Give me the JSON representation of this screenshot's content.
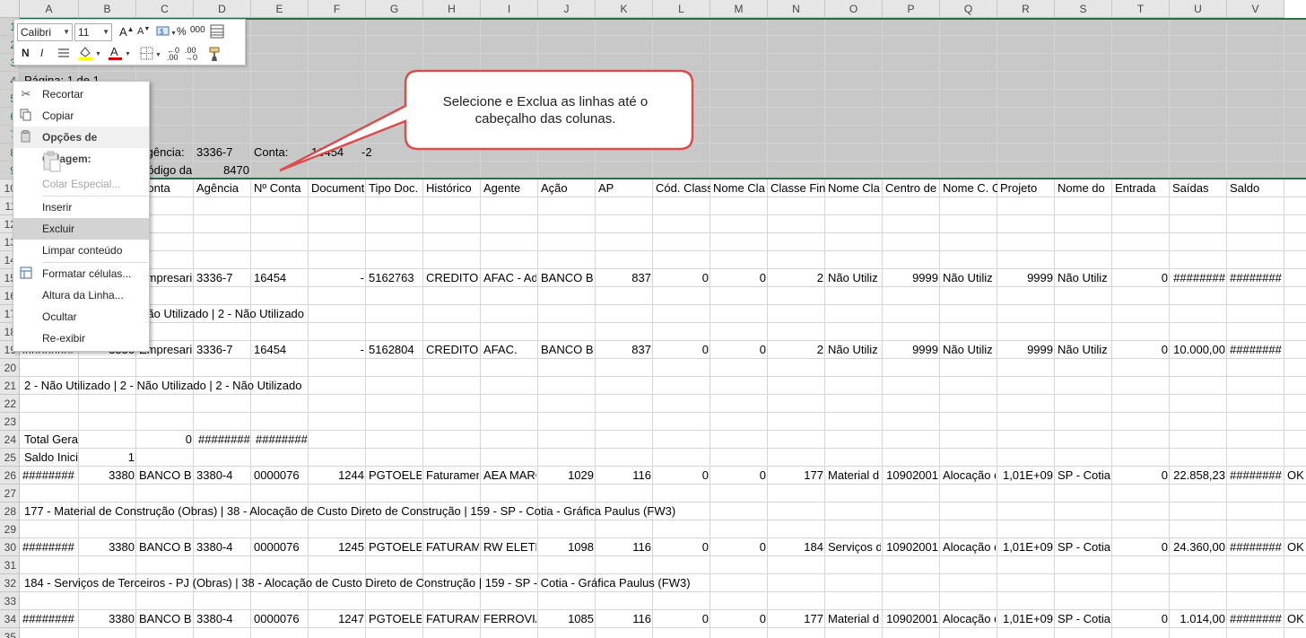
{
  "columns": [
    "A",
    "B",
    "C",
    "D",
    "E",
    "F",
    "G",
    "H",
    "I",
    "J",
    "K",
    "L",
    "M",
    "N",
    "O",
    "P",
    "Q",
    "R",
    "S",
    "T",
    "U",
    "V"
  ],
  "rows": [
    "1",
    "2",
    "3",
    "4",
    "5",
    "6",
    "7",
    "8",
    "9",
    "10",
    "11",
    "12",
    "13",
    "14",
    "15",
    "16",
    "17",
    "18",
    "19",
    "20",
    "21",
    "22",
    "23",
    "24",
    "25",
    "26",
    "27",
    "28",
    "29",
    "30",
    "31",
    "32",
    "33",
    "34",
    "35"
  ],
  "cells": {
    "r4_a": "Página: 1 de 1",
    "r8_c": "Agência:",
    "r8_d": "3336-7",
    "r8_e": "Conta:",
    "r8_f": "16454",
    "r8_g": "-2",
    "r9_c": "Código da",
    "r9_d": "8470",
    "h_c": "Conta",
    "h_d": "Agência",
    "h_e": "Nº Conta",
    "h_f": "Document",
    "h_g": "Tipo Doc.",
    "h_h": "Histórico",
    "h_i": "Agente",
    "h_j": "Ação",
    "h_k": "AP",
    "h_l": "Cód. Class",
    "h_m": "Nome Cla",
    "h_n": "Classe Fin",
    "h_o": "Nome Cla",
    "h_p": "Centro de",
    "h_q": "Nome C. C",
    "h_r": "Projeto",
    "h_s": "Nome do",
    "h_t": "Entrada",
    "h_u": "Saídas",
    "h_v": "Saldo",
    "r15": [
      "",
      "",
      "Empresari",
      "3336-7",
      "16454",
      "-",
      "5162763",
      "CREDITO",
      "AFAC - Ad",
      "BANCO BRADESCO S.",
      "837",
      "0",
      "0",
      "2",
      "Não Utiliz",
      "9999",
      "Não Utiliz",
      "9999",
      "Não Utiliz",
      "0",
      "########",
      "########"
    ],
    "r17_c": "Não Utilizado | 2 - Não Utilizado",
    "r19": [
      "########",
      "3336",
      "Empresari",
      "3336-7",
      "16454",
      "-",
      "5162804",
      "CREDITO",
      "AFAC.",
      "BANCO BRADESCO S.",
      "837",
      "0",
      "0",
      "2",
      "Não Utiliz",
      "9999",
      "Não Utiliz",
      "9999",
      "Não Utiliz",
      "0",
      "10.000,00",
      "########"
    ],
    "r21_a": "2 - Não Utilizado | 2 - Não Utilizado | 2 - Não Utilizado",
    "r24_a": "Total Gera",
    "r24_c": "0",
    "r24_d": "########",
    "r24_e": "########",
    "r25_a": "Saldo Inici",
    "r25_b": "1",
    "r26": [
      "########",
      "3380",
      "BANCO BR",
      "3380-4",
      "0000076",
      "1244",
      "PGTOELET",
      "Faturamen",
      "AEA MARC",
      "1029",
      "116",
      "0",
      "0",
      "177",
      "Material d",
      "10902001",
      "Alocação d",
      "1,01E+09",
      "SP - Cotia",
      "0",
      "22.858,23",
      "########",
      "OK"
    ],
    "r28_a": "177 - Material de Construção (Obras) | 38 - Alocação de Custo Direto de Construção | 159 - SP - Cotia - Gráfica Paulus (FW3)",
    "r30": [
      "########",
      "3380",
      "BANCO BR",
      "3380-4",
      "0000076",
      "1245",
      "PGTOELET",
      "FATURAM",
      "RW ELETR",
      "1098",
      "116",
      "0",
      "0",
      "184",
      "Serviços d",
      "10902001",
      "Alocação d",
      "1,01E+09",
      "SP - Cotia",
      "0",
      "24.360,00",
      "########",
      "OK"
    ],
    "r32_a": "184 - Serviços de Terceiros - PJ (Obras) | 38 - Alocação de Custo Direto de Construção | 159 - SP - Cotia - Gráfica Paulus (FW3)",
    "r34": [
      "########",
      "3380",
      "BANCO BR",
      "3380-4",
      "0000076",
      "1247",
      "PGTOELET",
      "FATURAM",
      "FERROVIA",
      "1085",
      "116",
      "0",
      "0",
      "177",
      "Material d",
      "10902001",
      "Alocação d",
      "1,01E+09",
      "SP - Cotia",
      "0",
      "1.014,00",
      "########",
      "OK"
    ]
  },
  "mini_toolbar": {
    "font_name": "Calibri",
    "font_size": "11",
    "bold": "N",
    "italic": "I",
    "increase_font": "A",
    "font_color_glyph": "A",
    "percent": "%",
    "thousands": "000"
  },
  "context_menu": {
    "recortar": "Recortar",
    "copiar": "Copiar",
    "opcoes_colagem": "Opções de Colagem:",
    "colar_especial": "Colar Especial...",
    "inserir": "Inserir",
    "excluir": "Excluir",
    "limpar": "Limpar conteúdo",
    "formatar": "Formatar células...",
    "altura": "Altura da Linha...",
    "ocultar": "Ocultar",
    "reexibir": "Re-exibir"
  },
  "callout": {
    "line1": "Selecione e Exclua as linhas até o",
    "line2": "cabeçalho das colunas."
  },
  "colors": {
    "accent": "#217346",
    "callout_border": "#d94f4f",
    "highlight_fill": "#ffff00",
    "font_color_red": "#d00000"
  }
}
